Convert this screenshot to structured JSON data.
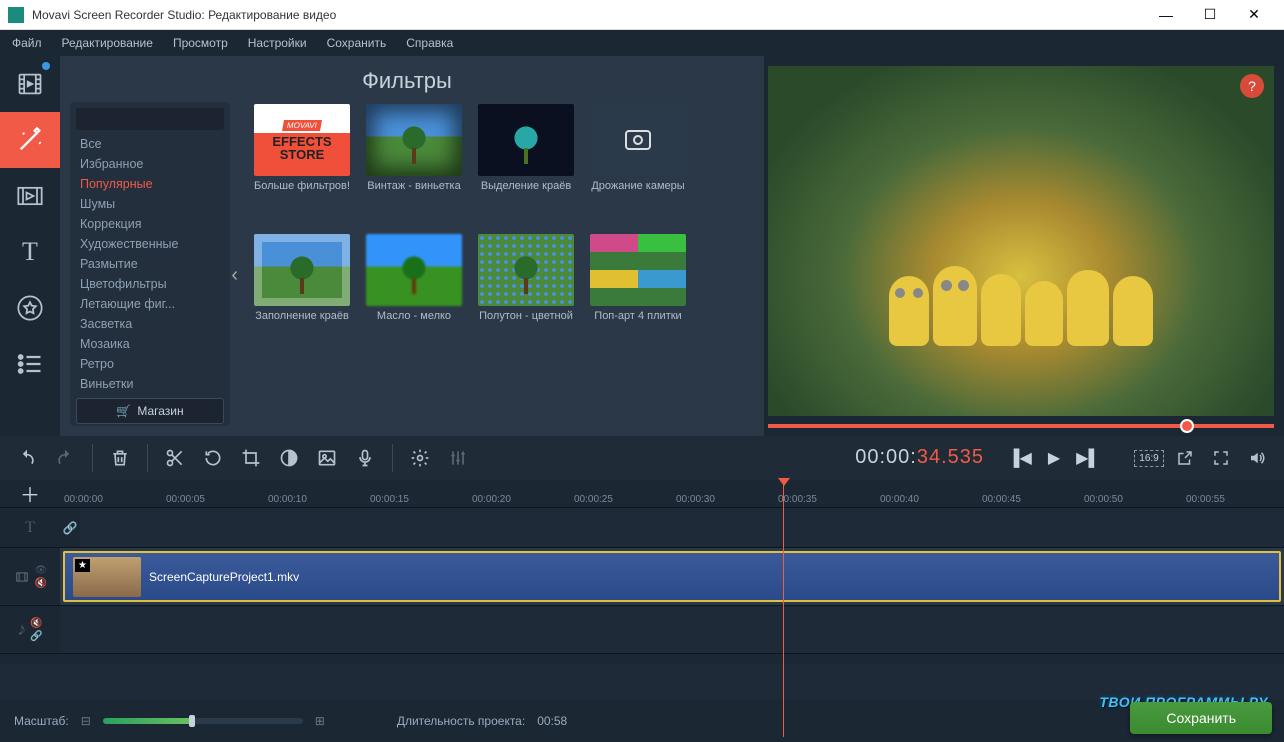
{
  "titlebar": {
    "title": "Movavi Screen Recorder Studio: Редактирование видео"
  },
  "menu": [
    "Файл",
    "Редактирование",
    "Просмотр",
    "Настройки",
    "Сохранить",
    "Справка"
  ],
  "panel": {
    "title": "Фильтры",
    "search_placeholder": "",
    "categories": [
      "Все",
      "Избранное",
      "Популярные",
      "Шумы",
      "Коррекция",
      "Художественные",
      "Размытие",
      "Цветофильтры",
      "Летающие фиг...",
      "Засветка",
      "Мозаика",
      "Ретро",
      "Виньетки"
    ],
    "active_category": "Популярные",
    "store_button": "Магазин",
    "filters": [
      {
        "label": "Больше фильтров!"
      },
      {
        "label": "Винтаж - виньетка"
      },
      {
        "label": "Выделение краёв"
      },
      {
        "label": "Дрожание камеры"
      },
      {
        "label": "Заполнение краёв"
      },
      {
        "label": "Масло - мелко"
      },
      {
        "label": "Полутон - цветной"
      },
      {
        "label": "Поп-арт 4 плитки"
      }
    ]
  },
  "timecode": {
    "gray": "00:00:",
    "orange": "34.535"
  },
  "ruler_ticks": [
    "00:00:00",
    "00:00:05",
    "00:00:10",
    "00:00:15",
    "00:00:20",
    "00:00:25",
    "00:00:30",
    "00:00:35",
    "00:00:40",
    "00:00:45",
    "00:00:50",
    "00:00:55"
  ],
  "clip": {
    "name": "ScreenCaptureProject1.mkv"
  },
  "ratio": "16:9",
  "status": {
    "zoom_label": "Масштаб:",
    "duration_label": "Длительность проекта:",
    "duration_value": "00:58",
    "save_button": "Сохранить"
  },
  "watermark": "ТВОИ ПРОГРАММЫ РУ"
}
